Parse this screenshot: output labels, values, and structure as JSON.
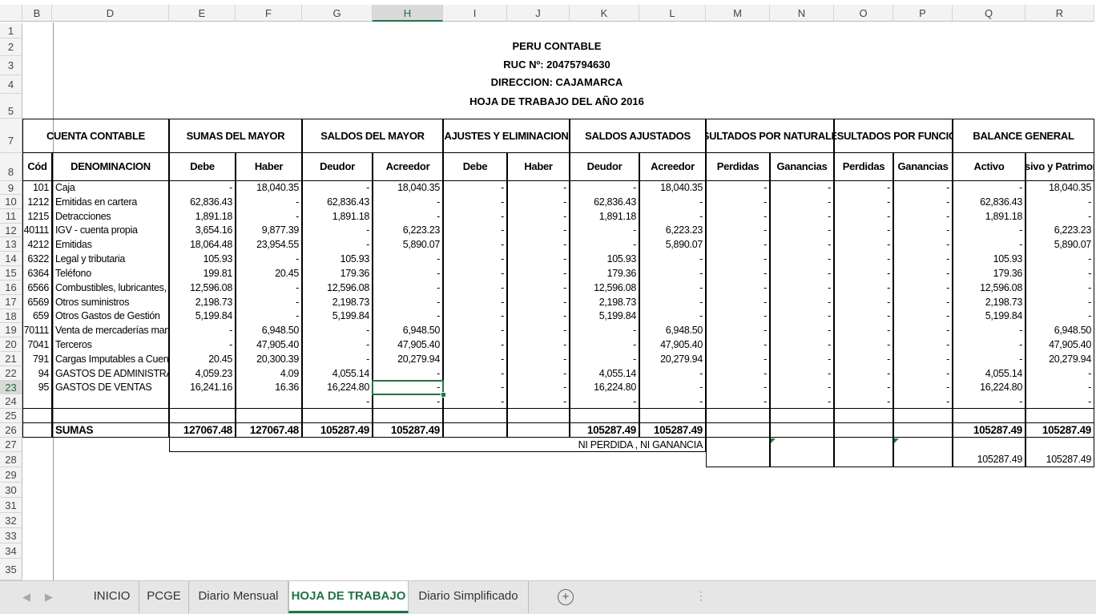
{
  "columns": [
    "B",
    "D",
    "E",
    "F",
    "G",
    "H",
    "I",
    "J",
    "K",
    "L",
    "M",
    "N",
    "O",
    "P",
    "Q",
    "R"
  ],
  "selected_column": "H",
  "selected_row": "23",
  "rows": [
    "1",
    "2",
    "3",
    "4",
    "5",
    "7",
    "8",
    "9",
    "10",
    "11",
    "12",
    "13",
    "14",
    "15",
    "16",
    "17",
    "18",
    "19",
    "20",
    "21",
    "22",
    "23",
    "24",
    "25",
    "26",
    "27",
    "28",
    "29",
    "30",
    "31",
    "32",
    "33",
    "34",
    "35"
  ],
  "title": {
    "company": "PERU CONTABLE",
    "ruc": "RUC Nº: 20475794630",
    "address": "DIRECCION:  CAJAMARCA",
    "report": "HOJA DE TRABAJO DEL AÑO 2016"
  },
  "group_headers": {
    "cuenta": "CUENTA CONTABLE",
    "sumas": "SUMAS DEL MAYOR",
    "saldos": "SALDOS DEL MAYOR",
    "ajustes": "AJUSTES Y ELIMINACION",
    "saldos_aj": "SALDOS AJUSTADOS",
    "res_nat": "RESULTADOS POR NATURALEZA",
    "res_fun": "RESULTADOS POR FUNCION",
    "balance": "BALANCE GENERAL"
  },
  "sub_headers": [
    "Cód",
    "DENOMINACION",
    "Debe",
    "Haber",
    "Deudor",
    "Acreedor",
    "Debe",
    "Haber",
    "Deudor",
    "Acreedor",
    "Perdidas",
    "Ganancias",
    "Perdidas",
    "Ganancias",
    "Activo",
    "Pasivo y Patrimonio"
  ],
  "table_rows": [
    [
      "101",
      "Caja",
      "-",
      "18,040.35",
      "-",
      "18,040.35",
      "-",
      "-",
      "-",
      "18,040.35",
      "-",
      "-",
      "-",
      "-",
      "-",
      "18,040.35"
    ],
    [
      "1212",
      "Emitidas en cartera",
      "62,836.43",
      "-",
      "62,836.43",
      "-",
      "-",
      "-",
      "62,836.43",
      "-",
      "-",
      "-",
      "-",
      "-",
      "62,836.43",
      "-"
    ],
    [
      "1215",
      "Detracciones",
      "1,891.18",
      "-",
      "1,891.18",
      "-",
      "-",
      "-",
      "1,891.18",
      "-",
      "-",
      "-",
      "-",
      "-",
      "1,891.18",
      "-"
    ],
    [
      "40111",
      "IGV - cuenta propia",
      "3,654.16",
      "9,877.39",
      "-",
      "6,223.23",
      "-",
      "-",
      "-",
      "6,223.23",
      "-",
      "-",
      "-",
      "-",
      "-",
      "6,223.23"
    ],
    [
      "4212",
      "Emitidas",
      "18,064.48",
      "23,954.55",
      "-",
      "5,890.07",
      "-",
      "-",
      "-",
      "5,890.07",
      "-",
      "-",
      "-",
      "-",
      "-",
      "5,890.07"
    ],
    [
      "6322",
      "Legal y tributaria",
      "105.93",
      "-",
      "105.93",
      "-",
      "-",
      "-",
      "105.93",
      "-",
      "-",
      "-",
      "-",
      "-",
      "105.93",
      "-"
    ],
    [
      "6364",
      "Teléfono",
      "199.81",
      "20.45",
      "179.36",
      "-",
      "-",
      "-",
      "179.36",
      "-",
      "-",
      "-",
      "-",
      "-",
      "179.36",
      "-"
    ],
    [
      "6566",
      "Combustibles, lubricantes, re",
      "12,596.08",
      "-",
      "12,596.08",
      "-",
      "-",
      "-",
      "12,596.08",
      "-",
      "-",
      "-",
      "-",
      "-",
      "12,596.08",
      "-"
    ],
    [
      "6569",
      "Otros suministros",
      "2,198.73",
      "-",
      "2,198.73",
      "-",
      "-",
      "-",
      "2,198.73",
      "-",
      "-",
      "-",
      "-",
      "-",
      "2,198.73",
      "-"
    ],
    [
      "659",
      "Otros Gastos de Gestión",
      "5,199.84",
      "-",
      "5,199.84",
      "-",
      "-",
      "-",
      "5,199.84",
      "-",
      "-",
      "-",
      "-",
      "-",
      "5,199.84",
      "-"
    ],
    [
      "70111",
      "Venta de mercaderías manu",
      "-",
      "6,948.50",
      "-",
      "6,948.50",
      "-",
      "-",
      "-",
      "6,948.50",
      "-",
      "-",
      "-",
      "-",
      "-",
      "6,948.50"
    ],
    [
      "7041",
      "Terceros",
      "-",
      "47,905.40",
      "-",
      "47,905.40",
      "-",
      "-",
      "-",
      "47,905.40",
      "-",
      "-",
      "-",
      "-",
      "-",
      "47,905.40"
    ],
    [
      "791",
      "Cargas Imputables a Cuenta",
      "20.45",
      "20,300.39",
      "-",
      "20,279.94",
      "-",
      "-",
      "-",
      "20,279.94",
      "-",
      "-",
      "-",
      "-",
      "-",
      "20,279.94"
    ],
    [
      "94",
      "GASTOS DE ADMINISTRACI",
      "4,059.23",
      "4.09",
      "4,055.14",
      "-",
      "-",
      "-",
      "4,055.14",
      "-",
      "-",
      "-",
      "-",
      "-",
      "4,055.14",
      "-"
    ],
    [
      "95",
      "GASTOS DE VENTAS",
      "16,241.16",
      "16.36",
      "16,224.80",
      "-",
      "-",
      "-",
      "16,224.80",
      "-",
      "-",
      "-",
      "-",
      "-",
      "16,224.80",
      "-"
    ],
    [
      "",
      "",
      "",
      "",
      "-",
      "-",
      "-",
      "-",
      "-",
      "-",
      "-",
      "-",
      "-",
      "-",
      "-",
      "-"
    ]
  ],
  "totals": {
    "label": "SUMAS",
    "debe": "127067.48",
    "haber": "127067.48",
    "deudor": "105287.49",
    "acreedor": "105287.49",
    "aj_deudor": "105287.49",
    "aj_acreedor": "105287.49",
    "activo": "105287.49",
    "pasivo": "105287.49"
  },
  "note": "NI PERDIDA , NI GANANCIA",
  "final": {
    "activo": "105287.49",
    "pasivo": "105287.49"
  },
  "tabs": [
    "INICIO",
    "PCGE",
    "Diario Mensual",
    "HOJA DE TRABAJO",
    "Diario Simplificado"
  ],
  "active_tab": "HOJA DE TRABAJO",
  "icons": {
    "add_sheet": "plus-circle-icon",
    "nav_prev": "left-arrow-icon",
    "nav_next": "right-arrow-icon"
  },
  "colors": {
    "accent": "#217346"
  }
}
